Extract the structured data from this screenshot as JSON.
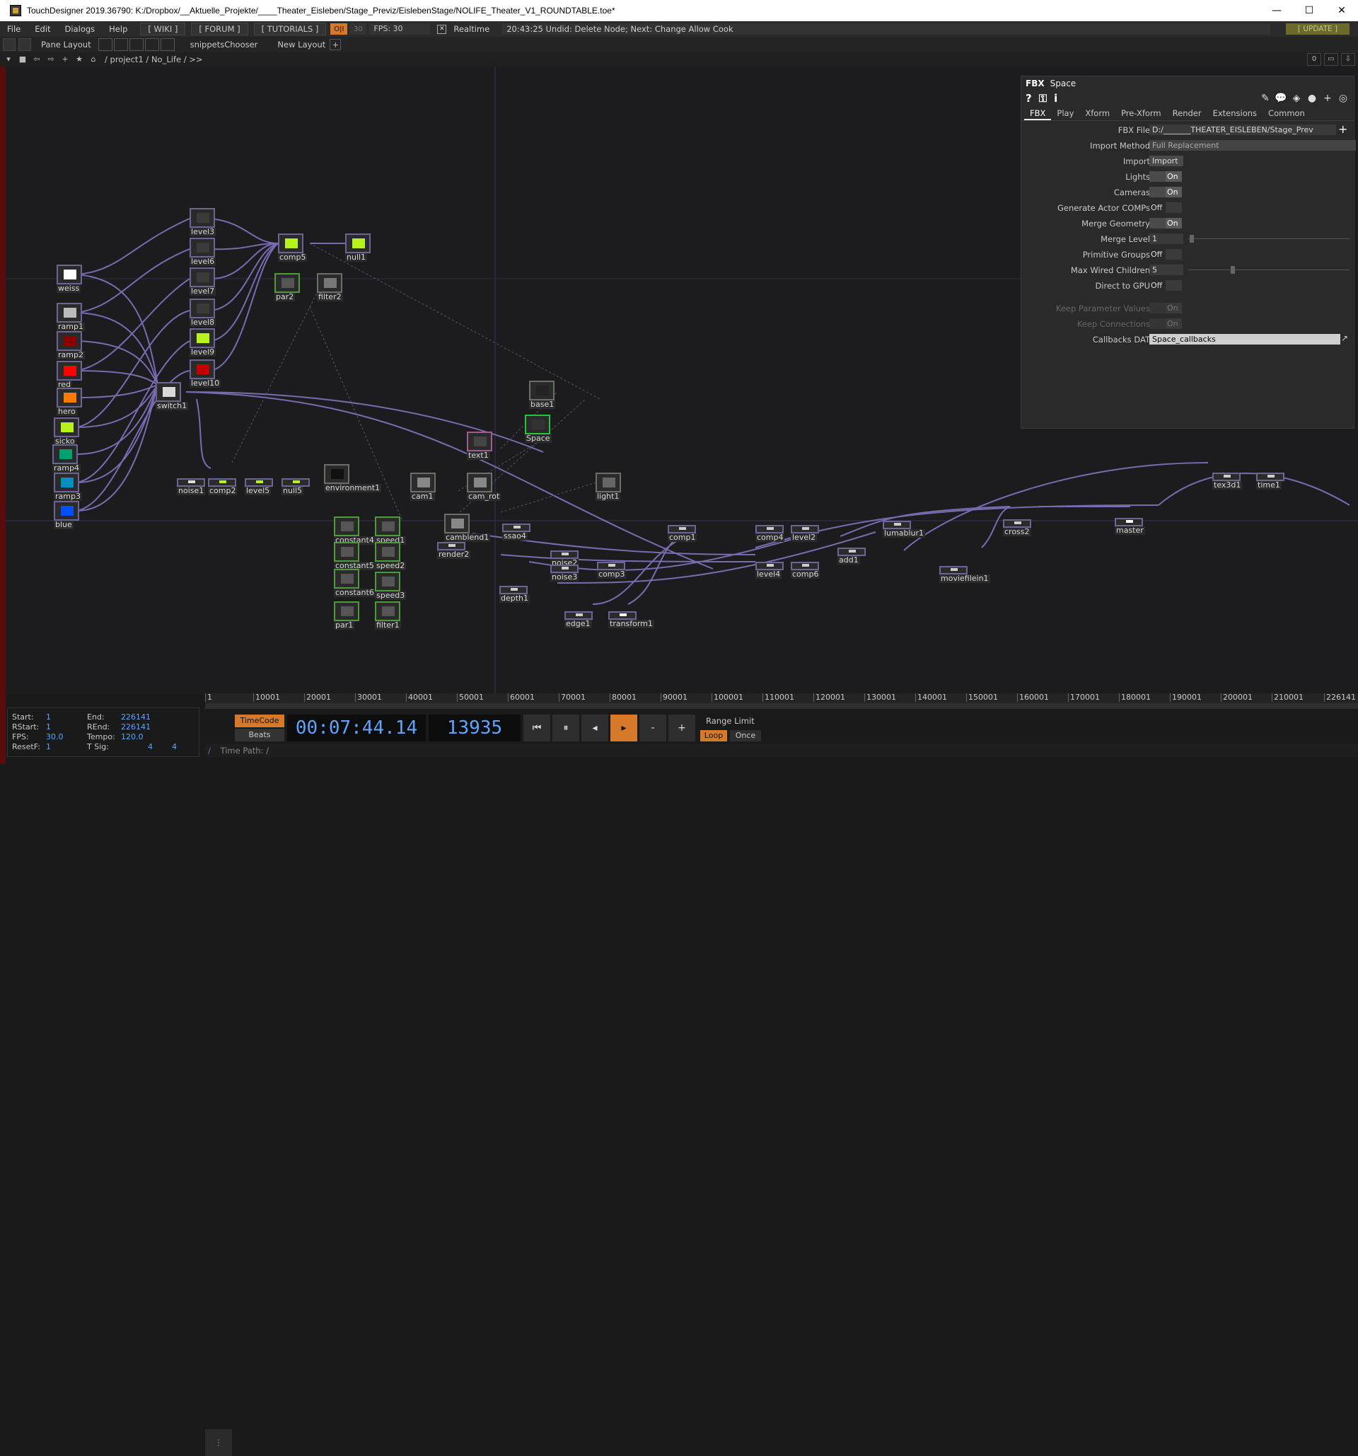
{
  "window": {
    "title": "TouchDesigner 2019.36790: K:/Dropbox/__Aktuelle_Projekte/____Theater_Eisleben/Stage_Previz/EislebenStage/NOLIFE_Theater_V1_ROUNDTABLE.toe*",
    "min": "—",
    "max": "☐",
    "close": "✕"
  },
  "menu": {
    "items": [
      "File",
      "Edit",
      "Dialogs",
      "Help"
    ],
    "wiki": "[ WIKI ]",
    "forum": "[ FORUM ]",
    "tutorials": "[ TUTORIALS ]",
    "oi": "O|I",
    "fps_small": "30",
    "fps": "FPS:  30",
    "realtime_check": "✕",
    "realtime": "Realtime",
    "status": "20:43:25 Undid: Delete Node; Next: Change Allow Cook",
    "update": "[ UPDATE ]"
  },
  "panebar": {
    "pane_layout": "Pane Layout",
    "snippets": "snippetsChooser",
    "new_layout": "New Layout",
    "plus": "+"
  },
  "pathbar": {
    "path": "/  project1  /  No_Life  /  >>",
    "right_buttons": [
      "0",
      "▭",
      "⇩"
    ]
  },
  "nodes": [
    {
      "name": "level3",
      "label": "level3",
      "kind": "top",
      "thumb": "#3a3a3a"
    },
    {
      "name": "level6",
      "label": "level6",
      "kind": "top",
      "thumb": "#3a3a3a"
    },
    {
      "name": "level7",
      "label": "level7",
      "kind": "top",
      "thumb": "#3a3a3a"
    },
    {
      "name": "level8",
      "label": "level8",
      "kind": "top",
      "thumb": "#3a3a3a"
    },
    {
      "name": "level9",
      "label": "level9",
      "kind": "top",
      "thumb": "#b6f21e"
    },
    {
      "name": "level10",
      "label": "level10",
      "kind": "top",
      "thumb": "#c50000"
    },
    {
      "name": "comp5",
      "label": "comp5",
      "kind": "top",
      "thumb": "#b6f21e"
    },
    {
      "name": "null1",
      "label": "null1",
      "kind": "top",
      "thumb": "#b6f21e"
    },
    {
      "name": "par2",
      "label": "par2",
      "kind": "green",
      "thumb": "#555555"
    },
    {
      "name": "filter2",
      "label": "filter2",
      "kind": "tex",
      "thumb": "#777777"
    },
    {
      "name": "weiss",
      "label": "weiss",
      "kind": "top",
      "thumb": "#ffffff"
    },
    {
      "name": "ramp1",
      "label": "ramp1",
      "kind": "top",
      "thumb": "#bbbbbb"
    },
    {
      "name": "ramp2",
      "label": "ramp2",
      "kind": "top",
      "thumb": "#8a0000"
    },
    {
      "name": "red",
      "label": "red",
      "kind": "top",
      "thumb": "#ff0000"
    },
    {
      "name": "hero",
      "label": "hero",
      "kind": "top",
      "thumb": "#ff7a00"
    },
    {
      "name": "sicko",
      "label": "sicko",
      "kind": "top",
      "thumb": "#b6f21e"
    },
    {
      "name": "ramp4",
      "label": "ramp4",
      "kind": "top",
      "thumb": "#00a070"
    },
    {
      "name": "ramp3",
      "label": "ramp3",
      "kind": "top",
      "thumb": "#0090c0"
    },
    {
      "name": "blue",
      "label": "blue",
      "kind": "top",
      "thumb": "#0050ff"
    },
    {
      "name": "switch1",
      "label": "switch1",
      "kind": "top",
      "thumb": "#d9d9d9"
    },
    {
      "name": "noise1",
      "label": "noise1",
      "kind": "small",
      "thumb": "#dddddd"
    },
    {
      "name": "comp2",
      "label": "comp2",
      "kind": "small",
      "thumb": "#b6f21e"
    },
    {
      "name": "level5",
      "label": "level5",
      "kind": "small",
      "thumb": "#b6f21e"
    },
    {
      "name": "null5",
      "label": "null5",
      "kind": "small",
      "thumb": "#b6f21e"
    },
    {
      "name": "environment1",
      "label": "environment1",
      "kind": "tex",
      "thumb": "#111111"
    },
    {
      "name": "base1",
      "label": "base1",
      "kind": "tex",
      "thumb": "#222222"
    },
    {
      "name": "space",
      "label": "Space",
      "kind": "sel",
      "thumb": "#333333"
    },
    {
      "name": "text1",
      "label": "text1",
      "kind": "pink",
      "thumb": "#444444"
    },
    {
      "name": "cam1",
      "label": "cam1",
      "kind": "tex",
      "thumb": "#888888"
    },
    {
      "name": "cam_rot",
      "label": "cam_rot",
      "kind": "tex",
      "thumb": "#888888"
    },
    {
      "name": "light1",
      "label": "light1",
      "kind": "tex",
      "thumb": "#666666"
    },
    {
      "name": "camblend1",
      "label": "camblend1",
      "kind": "tex",
      "thumb": "#888888"
    },
    {
      "name": "constant4",
      "label": "constant4",
      "kind": "green",
      "thumb": "#555555"
    },
    {
      "name": "speed1",
      "label": "speed1",
      "kind": "green",
      "thumb": "#555555"
    },
    {
      "name": "constant5",
      "label": "constant5",
      "kind": "green",
      "thumb": "#555555"
    },
    {
      "name": "speed2",
      "label": "speed2",
      "kind": "green",
      "thumb": "#555555"
    },
    {
      "name": "constant6",
      "label": "constant6",
      "kind": "green",
      "thumb": "#555555"
    },
    {
      "name": "speed3",
      "label": "speed3",
      "kind": "green",
      "thumb": "#555555"
    },
    {
      "name": "par1",
      "label": "par1",
      "kind": "green",
      "thumb": "#555555"
    },
    {
      "name": "filter1",
      "label": "filter1",
      "kind": "green",
      "thumb": "#555555"
    },
    {
      "name": "ssao4",
      "label": "ssao4",
      "kind": "small",
      "thumb": "#cccccc"
    },
    {
      "name": "render2",
      "label": "render2",
      "kind": "small",
      "thumb": "#cccccc"
    },
    {
      "name": "noise2",
      "label": "noise2",
      "kind": "small",
      "thumb": "#cccccc"
    },
    {
      "name": "noise3",
      "label": "noise3",
      "kind": "small",
      "thumb": "#cccccc"
    },
    {
      "name": "comp3",
      "label": "comp3",
      "kind": "small",
      "thumb": "#cccccc"
    },
    {
      "name": "comp1",
      "label": "comp1",
      "kind": "small",
      "thumb": "#cccccc"
    },
    {
      "name": "depth1",
      "label": "depth1",
      "kind": "small",
      "thumb": "#cccccc"
    },
    {
      "name": "edge1",
      "label": "edge1",
      "kind": "small",
      "thumb": "#cccccc"
    },
    {
      "name": "transform1",
      "label": "transform1",
      "kind": "small",
      "thumb": "#ffffff"
    },
    {
      "name": "comp4",
      "label": "comp4",
      "kind": "small",
      "thumb": "#cccccc"
    },
    {
      "name": "level2",
      "label": "level2",
      "kind": "small",
      "thumb": "#cccccc"
    },
    {
      "name": "level4",
      "label": "level4",
      "kind": "small",
      "thumb": "#cccccc"
    },
    {
      "name": "comp6",
      "label": "comp6",
      "kind": "small",
      "thumb": "#cccccc"
    },
    {
      "name": "add1",
      "label": "add1",
      "kind": "small",
      "thumb": "#cccccc"
    },
    {
      "name": "lumablur1",
      "label": "lumablur1",
      "kind": "small",
      "thumb": "#cccccc"
    },
    {
      "name": "moviefilein1",
      "label": "moviefilein1",
      "kind": "small",
      "thumb": "#cccccc"
    },
    {
      "name": "cross2",
      "label": "cross2",
      "kind": "small",
      "thumb": "#cccccc"
    },
    {
      "name": "master",
      "label": "master",
      "kind": "small",
      "thumb": "#ffffff"
    },
    {
      "name": "tex3d1",
      "label": "tex3d1",
      "kind": "small",
      "thumb": "#cccccc"
    },
    {
      "name": "time1",
      "label": "time1",
      "kind": "small",
      "thumb": "#cccccc"
    }
  ],
  "params": {
    "type": "FBX",
    "node_name": "Space",
    "icons": [
      "?",
      "⚿",
      "i"
    ],
    "tabs": [
      "FBX",
      "Play",
      "Xform",
      "Pre-Xform",
      "Render",
      "Extensions",
      "Common"
    ],
    "active_tab": "FBX",
    "rows": [
      {
        "label": "FBX File",
        "type": "field",
        "value": "D:/_______THEATER_EISLEBEN/Stage_Prev",
        "dim": false
      },
      {
        "label": "Import Method",
        "type": "dropdown",
        "value": "Full Replacement",
        "dim": false
      },
      {
        "label": "Import",
        "type": "btn",
        "value": "Import",
        "dim": false
      },
      {
        "label": "Lights",
        "type": "on",
        "value": "On",
        "dim": false
      },
      {
        "label": "Cameras",
        "type": "on",
        "value": "On",
        "dim": false
      },
      {
        "label": "Generate Actor COMPs",
        "type": "off",
        "value": "Off",
        "dim": false
      },
      {
        "label": "Merge Geometry",
        "type": "on",
        "value": "On",
        "dim": false
      },
      {
        "label": "Merge Level",
        "type": "fieldsm",
        "value": "1",
        "dim": false
      },
      {
        "label": "Primitive Groups",
        "type": "off",
        "value": "Off",
        "dim": false
      },
      {
        "label": "Max Wired Children",
        "type": "fieldsm",
        "value": "5",
        "dim": false
      },
      {
        "label": "Direct to GPU",
        "type": "off",
        "value": "Off",
        "dim": false
      },
      {
        "label": "Keep Parameter Values",
        "type": "on",
        "value": "On",
        "dim": true
      },
      {
        "label": "Keep Connections",
        "type": "on",
        "value": "On",
        "dim": true
      },
      {
        "label": "Callbacks DAT",
        "type": "white",
        "value": "Space_callbacks",
        "dim": false
      }
    ]
  },
  "timeline": {
    "ticks": [
      "1",
      "10001",
      "20001",
      "30001",
      "40001",
      "50001",
      "60001",
      "70001",
      "80001",
      "90001",
      "100001",
      "110001",
      "120001",
      "130001",
      "140001",
      "150001",
      "160001",
      "170001",
      "180001",
      "190001",
      "200001",
      "210001",
      "226141"
    ]
  },
  "info": {
    "start_k": "Start:",
    "start_v": "1",
    "end_k": "End:",
    "end_v": "226141",
    "rstart_k": "RStart:",
    "rstart_v": "1",
    "rend_k": "REnd:",
    "rend_v": "226141",
    "fps_k": "FPS:",
    "fps_v": "30.0",
    "tempo_k": "Tempo:",
    "tempo_v": "120.0",
    "resetf_k": "ResetF:",
    "resetf_v": "1",
    "tsig_k": "T Sig:",
    "tsig_v1": "4",
    "tsig_v2": "4"
  },
  "transport": {
    "timecode": "TimeCode",
    "beats": "Beats",
    "time": "00:07:44.14",
    "frame": "13935",
    "buttons": [
      "⏮",
      "⏸",
      "◂",
      "▸",
      "-",
      "+"
    ],
    "range_limit": "Range Limit",
    "loop": "Loop",
    "once": "Once",
    "time_path": "Time Path: /"
  },
  "colors": {
    "wire": "#7a6ab0",
    "accent": "#d6792a",
    "selected": "#26c43c",
    "time_text": "#5ea4ff"
  }
}
